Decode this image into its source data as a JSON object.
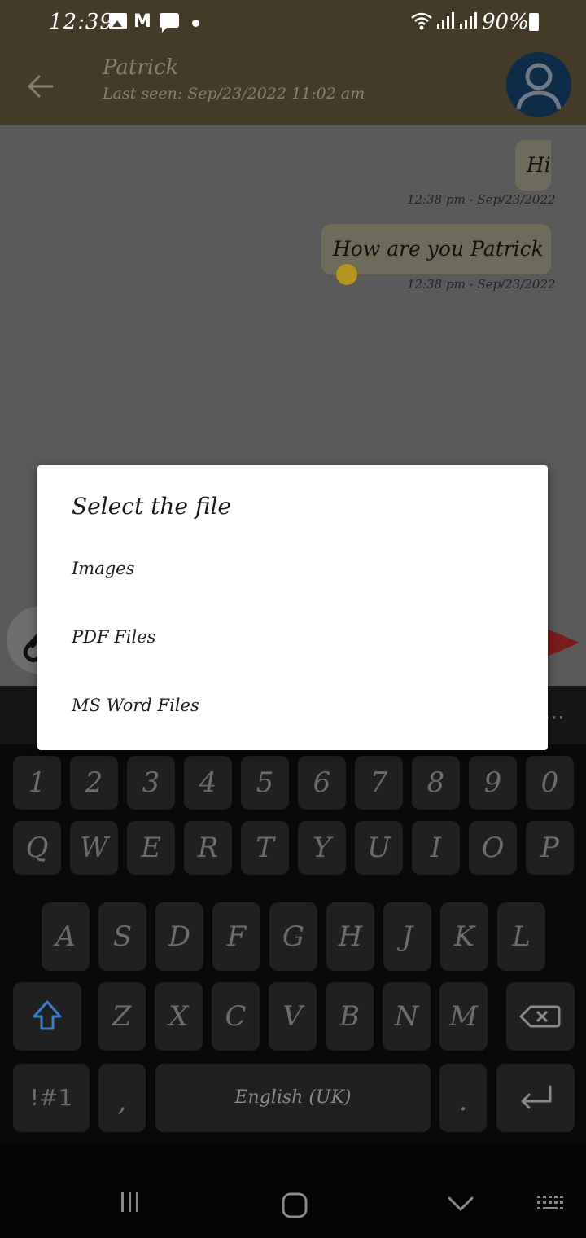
{
  "status_bar": {
    "time": "12:39",
    "battery": "90%",
    "icons": [
      "image-icon",
      "gmail-icon",
      "chat-icon",
      "dot-icon",
      "wifi-icon",
      "signal-icon",
      "signal-icon",
      "battery-icon"
    ]
  },
  "header": {
    "contact_name": "Patrick",
    "last_seen": "Last seen: Sep/23/2022 11:02 am"
  },
  "messages": [
    {
      "text": "Hi",
      "timestamp": "12:38 pm - Sep/23/2022"
    },
    {
      "text": "How are you Patrick",
      "timestamp": "12:38 pm - Sep/23/2022"
    }
  ],
  "dialog": {
    "title": "Select the file",
    "options": [
      "Images",
      "PDF Files",
      "MS Word Files"
    ]
  },
  "keyboard": {
    "row1": [
      "1",
      "2",
      "3",
      "4",
      "5",
      "6",
      "7",
      "8",
      "9",
      "0"
    ],
    "row2": [
      "Q",
      "W",
      "E",
      "R",
      "T",
      "Y",
      "U",
      "I",
      "O",
      "P"
    ],
    "row3": [
      "A",
      "S",
      "D",
      "F",
      "G",
      "H",
      "J",
      "K",
      "L"
    ],
    "row4": [
      "Z",
      "X",
      "C",
      "V",
      "B",
      "N",
      "M"
    ],
    "symbols_key": "!#1",
    "comma_key": ",",
    "space_key": "English (UK)",
    "period_key": "."
  },
  "colors": {
    "header": "#433b27",
    "chat_background": "#5a5a5a",
    "bubble": "#6f6b5b",
    "avatar": "#0c2c47",
    "send": "#7a1c1c",
    "keyboard": "#090909",
    "key": "#202020"
  }
}
